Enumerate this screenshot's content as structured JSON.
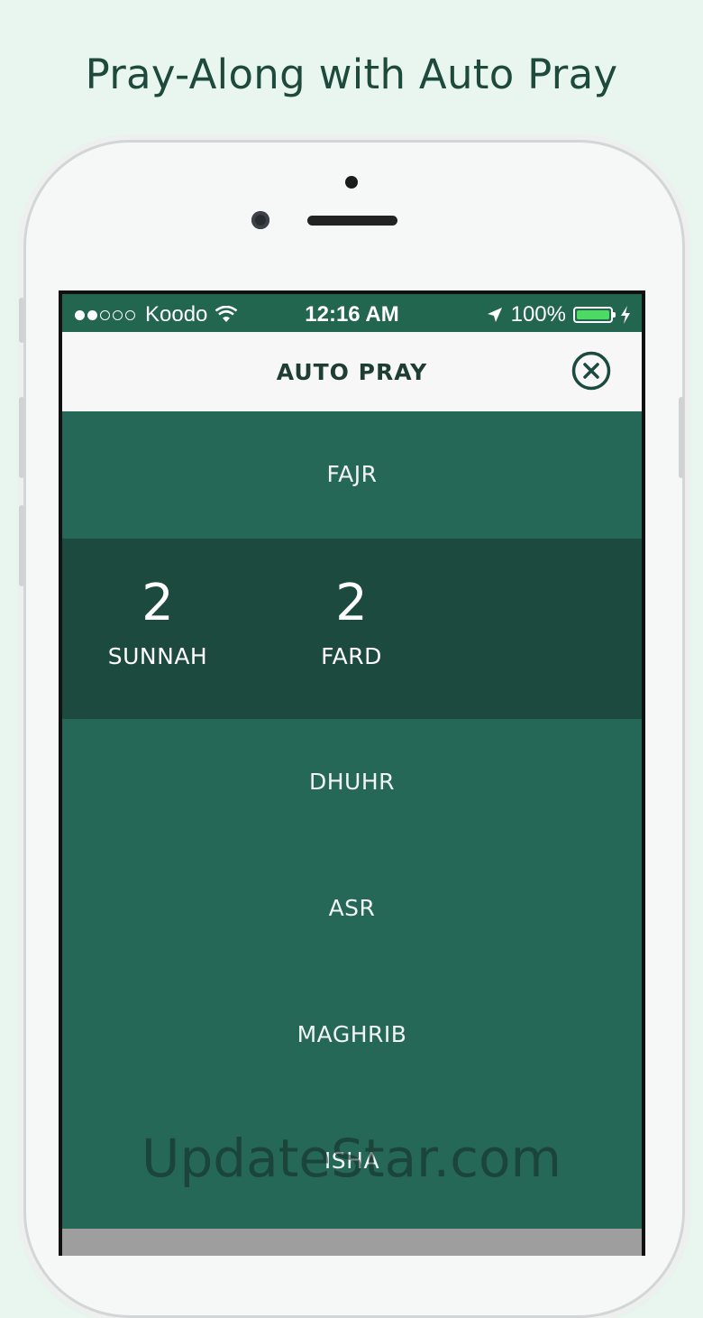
{
  "headline": "Pray-Along with Auto Pray",
  "status_bar": {
    "carrier": "Koodo",
    "time": "12:16 AM",
    "battery": "100%",
    "signal_icon": "signal-dots-icon",
    "wifi_icon": "wifi-icon",
    "location_icon": "location-arrow-icon",
    "charging_icon": "bolt-icon"
  },
  "nav": {
    "title": "AUTO PRAY",
    "close_icon": "close-circle-icon"
  },
  "prayers": {
    "fajr": {
      "label": "FAJR",
      "sunnah_count": "2",
      "sunnah_label": "SUNNAH",
      "fard_count": "2",
      "fard_label": "FARD"
    },
    "dhuhr": "DHUHR",
    "asr": "ASR",
    "maghrib": "MAGHRIB",
    "isha": "ISHA"
  },
  "watermark": "UpdateStar.com",
  "colors": {
    "background": "#e9f6ef",
    "accent_green": "#256857",
    "expanded_green": "#1c4a3f",
    "status_green": "#23664f"
  }
}
